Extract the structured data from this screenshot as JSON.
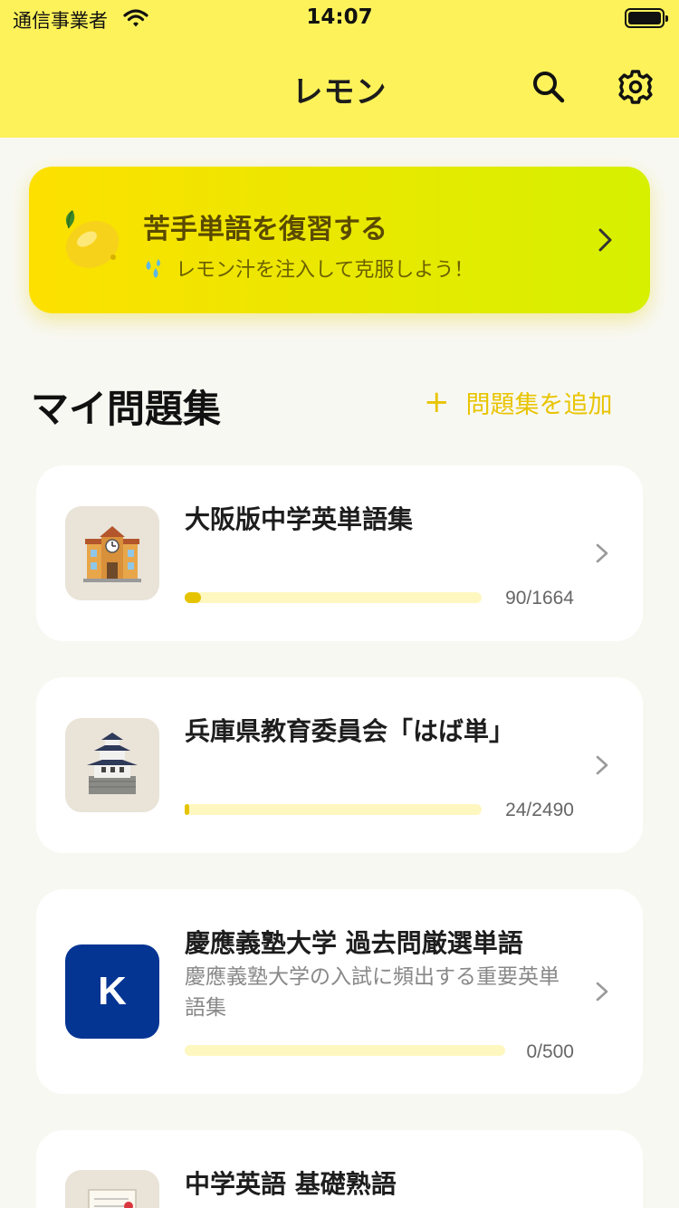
{
  "status_bar": {
    "carrier": "通信事業者",
    "time": "14:07"
  },
  "header": {
    "title": "レモン",
    "search_icon": "search-icon",
    "settings_icon": "gear-icon"
  },
  "review_banner": {
    "title": "苦手単語を復習する",
    "subtitle": "レモン汁を注入して克服しよう！",
    "icon": "lemon-icon",
    "subtitle_icon": "droplets-icon"
  },
  "section": {
    "title": "マイ問題集",
    "add_label": "問題集を追加"
  },
  "collections": [
    {
      "title": "大阪版中学英単語集",
      "description": "",
      "progress": "90/1664",
      "progress_ratio": 0.054,
      "icon": "school-building-icon"
    },
    {
      "title": "兵庫県教育委員会「はば単」",
      "description": "",
      "progress": "24/2490",
      "progress_ratio": 0.01,
      "icon": "castle-icon"
    },
    {
      "title": "慶應義塾大学 過去問厳選単語",
      "description": "慶應義塾大学の入試に頻出する重要英単語集",
      "progress": "0/500",
      "progress_ratio": 0,
      "icon": "letter-k-icon",
      "icon_letter": "K"
    },
    {
      "title": "中学英語 基礎熟語",
      "description": "",
      "icon": "letter-paper-icon"
    }
  ],
  "colors": {
    "header_bg": "#fdf25a",
    "accent": "#e6c300",
    "banner_start": "#fde000",
    "banner_end": "#d6f000",
    "k_tile": "#053593"
  }
}
